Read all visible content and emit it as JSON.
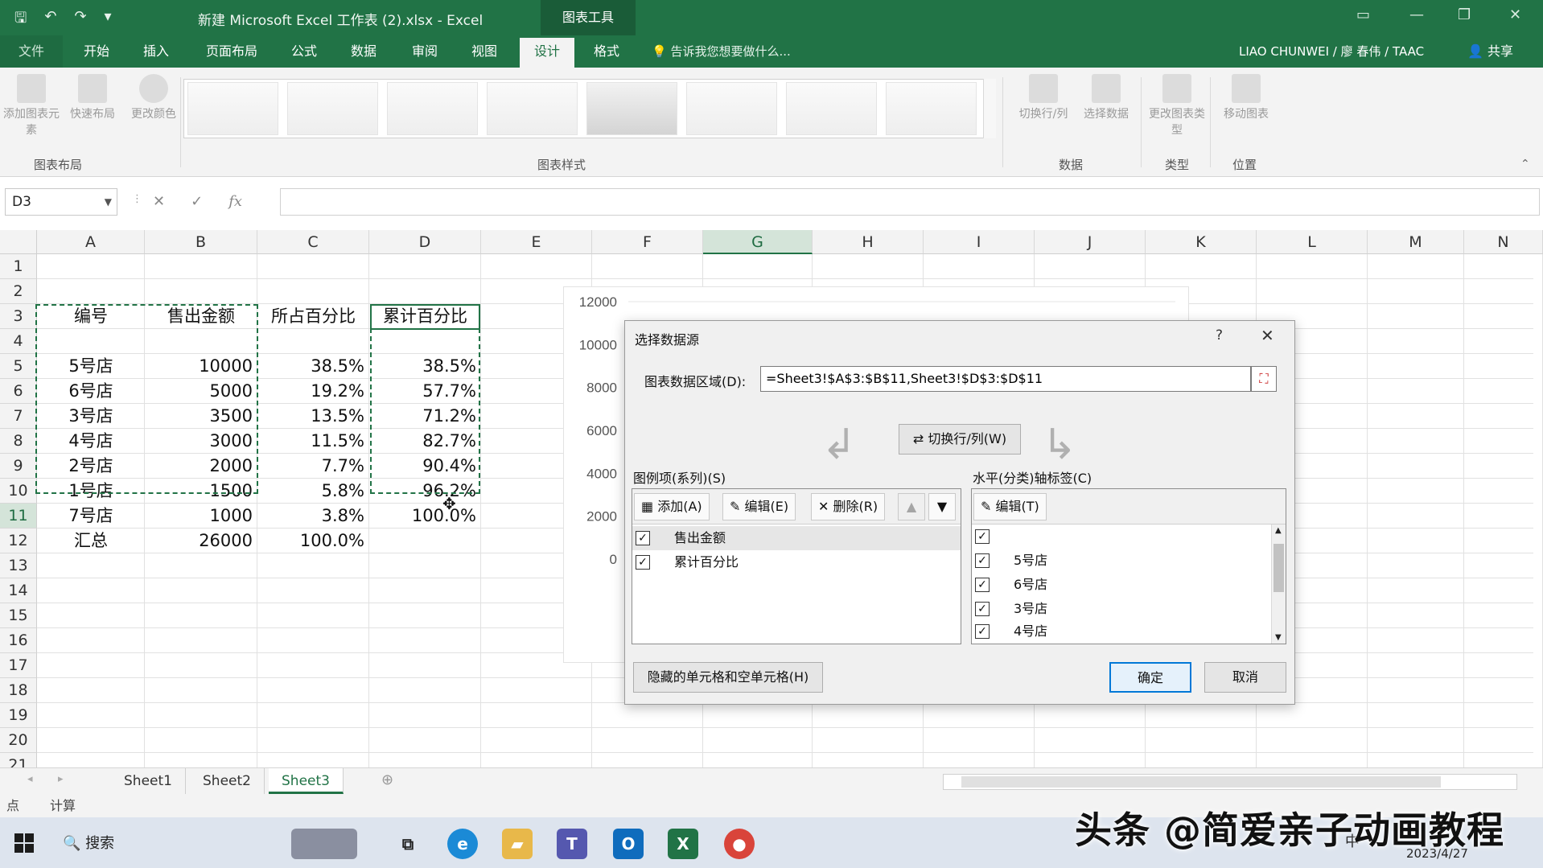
{
  "window": {
    "title": "新建 Microsoft Excel 工作表 (2).xlsx - Excel",
    "context_tab": "图表工具"
  },
  "ribbon_tabs": [
    "文件",
    "开始",
    "插入",
    "页面布局",
    "公式",
    "数据",
    "审阅",
    "视图",
    "设计",
    "格式"
  ],
  "tell_me": "告诉我您想要做什么...",
  "user": "LIAO CHUNWEI / 廖 春伟 / TAAC",
  "share": "共享",
  "ribbon": {
    "add_element": "添加图表元素",
    "quick_layout": "快速布局",
    "change_color": "更改颜色",
    "switch_rowcol": "切换行/列",
    "select_data": "选择数据",
    "change_type": "更改图表类型",
    "move_chart": "移动图表",
    "group_layout": "图表布局",
    "group_styles": "图表样式",
    "group_data": "数据",
    "group_type": "类型",
    "group_location": "位置"
  },
  "formula_bar": {
    "name_box": "D3",
    "fx": "fx",
    "formula": ""
  },
  "columns": [
    "A",
    "B",
    "C",
    "D",
    "E",
    "F",
    "G",
    "H",
    "I",
    "J",
    "K",
    "L",
    "M",
    "N"
  ],
  "rows": [
    "1",
    "2",
    "3",
    "4",
    "5",
    "6",
    "7",
    "8",
    "9",
    "10",
    "11",
    "12",
    "13",
    "14",
    "15",
    "16",
    "17",
    "18",
    "19",
    "20",
    "21"
  ],
  "table": {
    "headers": [
      "编号",
      "售出金额",
      "所占百分比",
      "累计百分比"
    ],
    "rows": [
      [
        "5号店",
        "10000",
        "38.5%",
        "38.5%"
      ],
      [
        "6号店",
        "5000",
        "19.2%",
        "57.7%"
      ],
      [
        "3号店",
        "3500",
        "13.5%",
        "71.2%"
      ],
      [
        "4号店",
        "3000",
        "11.5%",
        "82.7%"
      ],
      [
        "2号店",
        "2000",
        "7.7%",
        "90.4%"
      ],
      [
        "1号店",
        "1500",
        "5.8%",
        "96.2%"
      ],
      [
        "7号店",
        "1000",
        "3.8%",
        "100.0%"
      ]
    ],
    "total": [
      "汇总",
      "26000",
      "100.0%"
    ]
  },
  "chart_data": {
    "type": "bar",
    "y_ticks": [
      "12000",
      "10000",
      "8000",
      "6000",
      "4000",
      "2000",
      "0"
    ],
    "ylim": [
      0,
      12000
    ]
  },
  "dialog": {
    "title": "选择数据源",
    "help": "?",
    "close": "✕",
    "range_label": "图表数据区域(D):",
    "range_value": "=Sheet3!$A$3:$B$11,Sheet3!$D$3:$D$11",
    "switch_label": "切换行/列(W)",
    "series_label": "图例项(系列)(S)",
    "axis_label": "水平(分类)轴标签(C)",
    "add": "添加(A)",
    "edit": "编辑(E)",
    "delete": "删除(R)",
    "edit_axis": "编辑(T)",
    "series": [
      "售出金额",
      "累计百分比"
    ],
    "categories": [
      "",
      "5号店",
      "6号店",
      "3号店",
      "4号店"
    ],
    "hidden_cells": "隐藏的单元格和空单元格(H)",
    "ok": "确定",
    "cancel": "取消"
  },
  "sheets": [
    "Sheet1",
    "Sheet2",
    "Sheet3"
  ],
  "status": {
    "ready": "点",
    "calc": "计算"
  },
  "taskbar": {
    "search": "搜索",
    "date": "2023/4/27",
    "ime": "中"
  },
  "watermark": "头条 @简爱亲子动画教程",
  "colors": {
    "excel_green": "#217346",
    "accent_blue": "#0078d7"
  }
}
